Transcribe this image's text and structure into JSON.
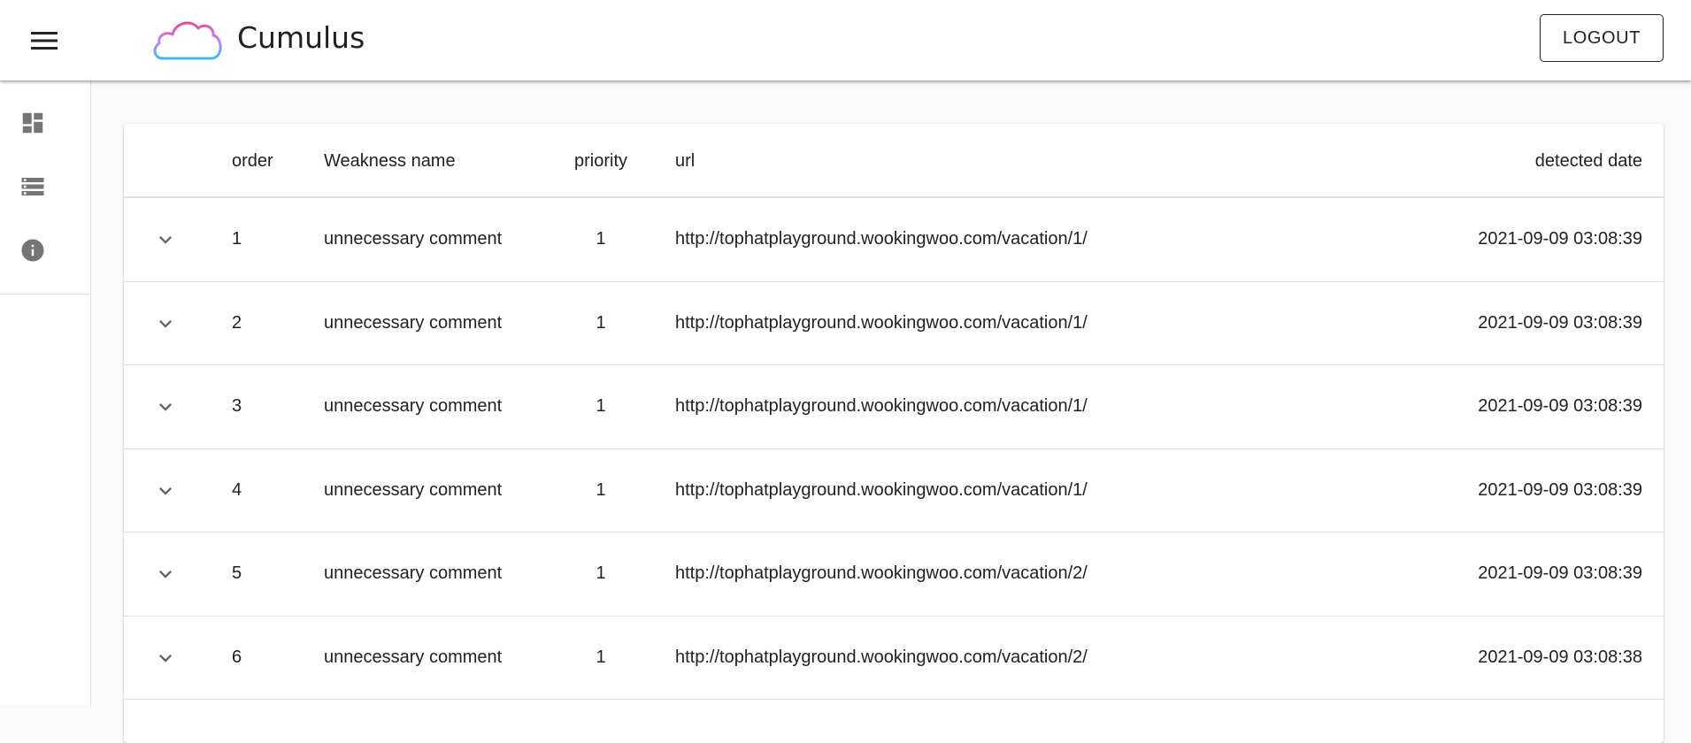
{
  "header": {
    "brand": "Cumulus",
    "logout_label": "LOGOUT"
  },
  "sidebar": {
    "items": [
      {
        "icon": "dashboard-icon"
      },
      {
        "icon": "storage-icon"
      },
      {
        "icon": "info-icon"
      }
    ]
  },
  "table": {
    "columns": {
      "order": "order",
      "name": "Weakness name",
      "priority": "priority",
      "url": "url",
      "date": "detected date"
    },
    "rows": [
      {
        "order": "1",
        "name": "unnecessary comment",
        "priority": "1",
        "url": "http://tophatplayground.wookingwoo.com/vacation/1/",
        "date": "2021-09-09 03:08:39"
      },
      {
        "order": "2",
        "name": "unnecessary comment",
        "priority": "1",
        "url": "http://tophatplayground.wookingwoo.com/vacation/1/",
        "date": "2021-09-09 03:08:39"
      },
      {
        "order": "3",
        "name": "unnecessary comment",
        "priority": "1",
        "url": "http://tophatplayground.wookingwoo.com/vacation/1/",
        "date": "2021-09-09 03:08:39"
      },
      {
        "order": "4",
        "name": "unnecessary comment",
        "priority": "1",
        "url": "http://tophatplayground.wookingwoo.com/vacation/1/",
        "date": "2021-09-09 03:08:39"
      },
      {
        "order": "5",
        "name": "unnecessary comment",
        "priority": "1",
        "url": "http://tophatplayground.wookingwoo.com/vacation/2/",
        "date": "2021-09-09 03:08:39"
      },
      {
        "order": "6",
        "name": "unnecessary comment",
        "priority": "1",
        "url": "http://tophatplayground.wookingwoo.com/vacation/2/",
        "date": "2021-09-09 03:08:38"
      }
    ]
  },
  "colors": {
    "icon_gray": "#757575",
    "logo_pink": "#ec4899",
    "logo_blue": "#38bdf8",
    "text": "#212121",
    "divider": "#e0e0e0"
  }
}
